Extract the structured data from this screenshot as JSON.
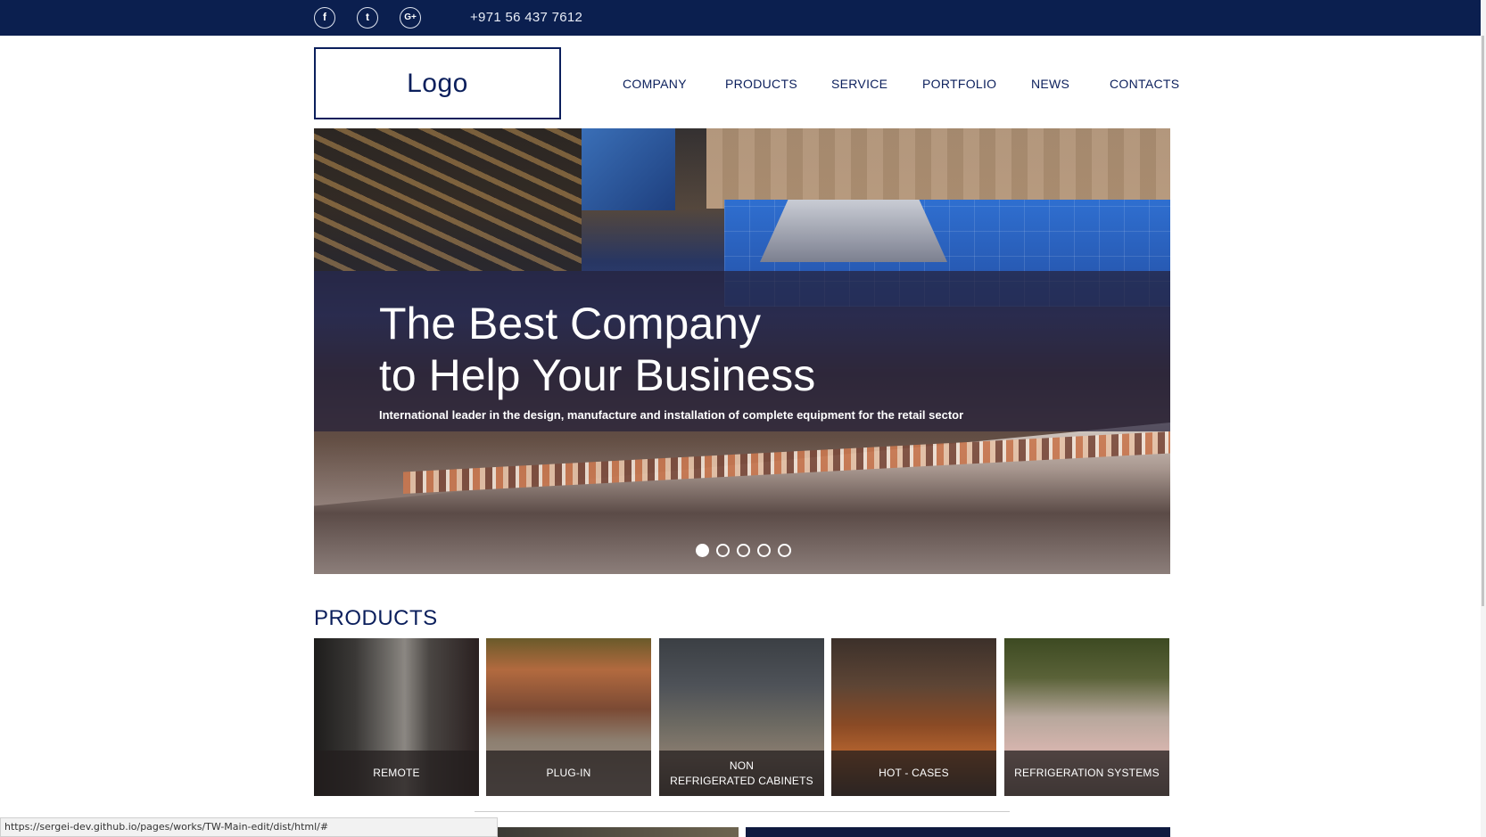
{
  "topbar": {
    "social": [
      {
        "name": "facebook",
        "glyph": "f"
      },
      {
        "name": "twitter",
        "glyph": "t"
      },
      {
        "name": "google-plus",
        "glyph": "G+"
      }
    ],
    "phone": "+971 56 437 7612"
  },
  "header": {
    "logo": "Logo",
    "nav": [
      "COMPANY",
      "PRODUCTS",
      "SERVICE",
      "PORTFOLIO",
      "NEWS",
      "CONTACTS"
    ]
  },
  "hero": {
    "title_line1": "The Best Company",
    "title_line2": "to Help Your Business",
    "subtitle": "International leader in the design, manufacture and installation of complete equipment for the retail sector",
    "slide_count": 5,
    "active_slide": 1
  },
  "products": {
    "title": "PRODUCTS",
    "items": [
      {
        "label": "REMOTE"
      },
      {
        "label": "PLUG-IN"
      },
      {
        "label": "NON\nREFRIGERATED CABINETS"
      },
      {
        "label": "HOT - CASES"
      },
      {
        "label": "REFRIGERATION SYSTEMS"
      }
    ]
  },
  "status": {
    "url": "https://sergei-dev.github.io/pages/works/TW-Main-edit/dist/html/#"
  },
  "colors": {
    "topbar": "#0b1f4f",
    "brand_text": "#0b1f5c",
    "overlay": "#26213a"
  }
}
